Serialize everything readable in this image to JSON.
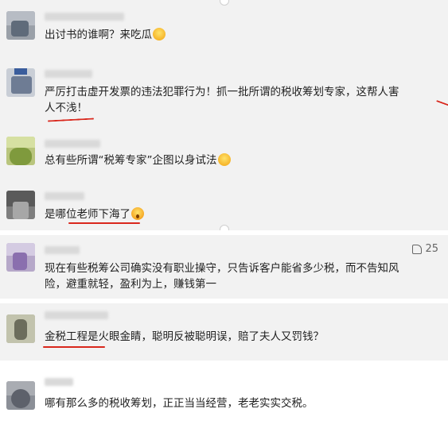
{
  "comments_top": [
    {
      "text": "出讨书的谁啊？来吃瓜",
      "emoji": "laugh-icon"
    },
    {
      "text_line1": "严厉打击虚开发票的违法犯罪行为！抓一批所谓的税收筹划专家，这帮人害",
      "text_line2": "人不浅！"
    },
    {
      "text": "总有些所谓“税筹专家”企图以身试法",
      "emoji": "laugh-icon"
    },
    {
      "text": "是哪位老师下海了",
      "emoji": "shocked-face-icon"
    }
  ],
  "comments_bottom": [
    {
      "likes": "25",
      "text_line1": "现在有些税筹公司确实没有职业操守，只告诉客户能省多少税，而不告知风",
      "text_line2": "险，避重就轻，盈利为上，赚钱第一"
    },
    {
      "text": "金税工程是火眼金睛，聪明反被聪明误，赔了夫人又罚钱？"
    },
    {
      "text": "哪有那么多的税收筹划，正正当当经营，老老实实交税。"
    }
  ]
}
